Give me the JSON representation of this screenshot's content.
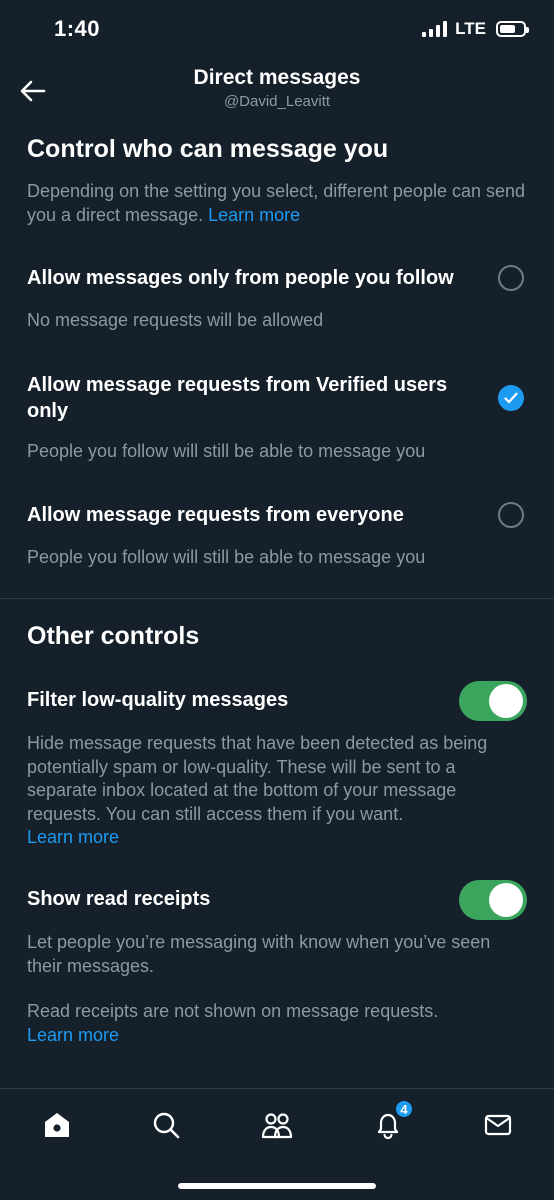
{
  "status_bar": {
    "time": "1:40",
    "network": "LTE"
  },
  "header": {
    "title": "Direct messages",
    "username": "@David_Leavitt",
    "back_icon": "arrow-left-icon"
  },
  "control_section": {
    "title": "Control who can message you",
    "description": "Depending on the setting you select, different people can send you a direct message.",
    "learn_more": "Learn more",
    "options": [
      {
        "label": "Allow messages only from people you follow",
        "sublabel": "No message requests will be allowed",
        "selected": false
      },
      {
        "label": "Allow message requests from Verified users only",
        "sublabel": "People you follow will still be able to message you",
        "selected": true
      },
      {
        "label": "Allow message requests from everyone",
        "sublabel": "People you follow will still be able to message you",
        "selected": false
      }
    ]
  },
  "other_section": {
    "title": "Other controls",
    "filter": {
      "label": "Filter low-quality messages",
      "description": "Hide message requests that have been detected as being potentially spam or low-quality. These will be sent to a separate inbox located at the bottom of your message requests. You can still access them if you want.",
      "learn_more": "Learn more",
      "enabled": true
    },
    "read_receipts": {
      "label": "Show read receipts",
      "description": "Let people you’re messaging with know when you’ve seen their messages.",
      "note": "Read receipts are not shown on message requests.",
      "learn_more": "Learn more",
      "enabled": true
    }
  },
  "tab_bar": {
    "tabs": [
      "home-icon",
      "search-icon",
      "communities-icon",
      "notifications-icon",
      "messages-icon"
    ],
    "notification_count": "4"
  },
  "colors": {
    "background": "#15202b",
    "accent": "#1d9bf0",
    "toggle_on": "#3ba55d",
    "secondary_text": "#8b98a5"
  }
}
